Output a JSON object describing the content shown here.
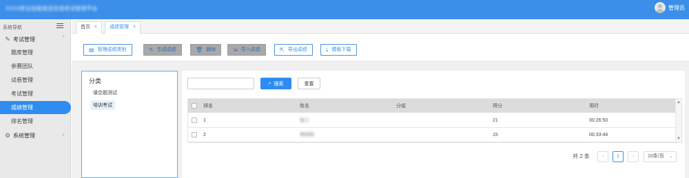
{
  "header": {
    "app_title": "XXXX职业技能鉴定在线考试管理平台",
    "user_name": "管理员"
  },
  "sidebar": {
    "heading": "系统导航",
    "groups": [
      {
        "label": "考试管理",
        "expanded": true
      },
      {
        "label": "系统管理",
        "expanded": false
      }
    ],
    "items": [
      {
        "label": "题库管理"
      },
      {
        "label": "参赛团队"
      },
      {
        "label": "试卷管理"
      },
      {
        "label": "考试管理"
      },
      {
        "label": "成绩管理",
        "active": true
      },
      {
        "label": "排名管理"
      }
    ]
  },
  "tabs": [
    {
      "label": "首页"
    },
    {
      "label": "成绩管理",
      "active": true
    }
  ],
  "toolbar": {
    "manage_category": "管理成绩类别",
    "generate": "生成成绩",
    "delete": "删除",
    "import": "导入成绩",
    "export": "导出成绩",
    "template": "模板下载"
  },
  "category": {
    "title": "分类",
    "items": [
      {
        "label": "填空题测试"
      },
      {
        "label": "培训考试",
        "selected": true
      }
    ]
  },
  "search": {
    "placeholder": "",
    "search_label": "搜索",
    "reset_label": "重置"
  },
  "table": {
    "columns": [
      "排名",
      "姓名",
      "分组",
      "得分",
      "用时"
    ],
    "rows": [
      {
        "rank": "1",
        "name": "张三",
        "group": "",
        "score": "21",
        "time": "00:26:50"
      },
      {
        "rank": "2",
        "name": "李四四",
        "group": "",
        "score": "15",
        "time": "00:33:44"
      }
    ]
  },
  "pagination": {
    "total": "共 2 条",
    "current_page": "1",
    "page_size": "10条/页",
    "prev": "‹",
    "next": "›"
  },
  "colors": {
    "topbar": "#3c8fe8",
    "accent": "#2e8cf0",
    "sidebar_bg": "#e9e9e9"
  }
}
